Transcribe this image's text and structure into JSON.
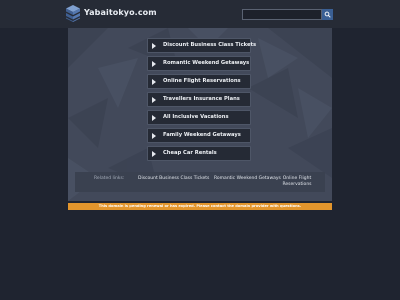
{
  "header": {
    "site_name": "Yabaitokyo.com",
    "logo_icon": "stacked-cubes-logo",
    "search_placeholder": "",
    "search_icon": "magnifier"
  },
  "links": [
    {
      "label": "Discount Business Class Tickets"
    },
    {
      "label": "Romantic Weekend Getaways"
    },
    {
      "label": "Online Flight Reservations"
    },
    {
      "label": "Travellers Insurance Plans"
    },
    {
      "label": "All Inclusive Vacations"
    },
    {
      "label": "Family Weekend Getaways"
    },
    {
      "label": "Cheap Car Rentals"
    }
  ],
  "related": {
    "title": "Related links:",
    "items": [
      {
        "label": "Discount Business Class Tickets"
      },
      {
        "label": "Romantic Weekend Getaways"
      },
      {
        "label": "Online Flight Reservations"
      }
    ]
  },
  "notice": {
    "text": "This domain is pending renewal or has expired. Please contact the domain provider with questions."
  },
  "colors": {
    "background": "#1f2430",
    "panel": "#42495a",
    "link_bg": "#252a35",
    "notice": "#e2952c",
    "search_button": "#3a5f94"
  }
}
